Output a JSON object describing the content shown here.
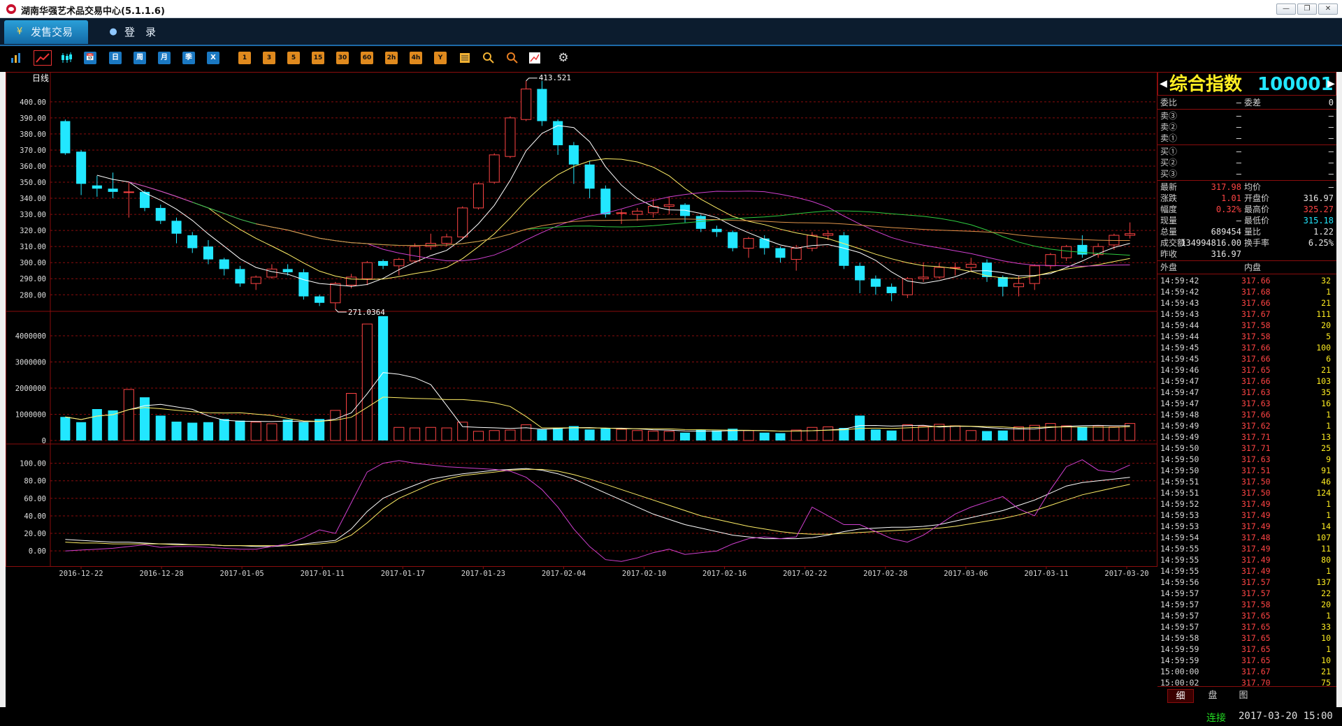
{
  "window": {
    "title": "湖南华强艺术品交易中心(5.1.1.6)",
    "buttons": [
      "—",
      "❐",
      "✕"
    ]
  },
  "nav": {
    "tabs": [
      {
        "label": "发售交易",
        "icon": "yen-icon"
      },
      {
        "label": "登　录",
        "icon": "user-icon"
      }
    ]
  },
  "toolbar": {
    "groups": [
      {
        "kind": "plain",
        "items": [
          "bar-chart-icon",
          "line-chart-icon",
          "candlestick-icon"
        ]
      },
      {
        "kind": "period",
        "items": [
          "📅",
          "日",
          "周",
          "月",
          "季",
          "X"
        ]
      },
      {
        "kind": "minutes",
        "items": [
          "1",
          "3",
          "5",
          "15",
          "30",
          "60",
          "2h",
          "4h",
          "Y"
        ]
      },
      {
        "kind": "tools",
        "items": [
          "list-icon",
          "zoom-in-icon",
          "zoom-out-icon",
          "draw-icon",
          "gear-icon"
        ]
      }
    ]
  },
  "chart_data": {
    "type": "candlestick",
    "period_label": "日线",
    "price_axis": {
      "ticks": [
        "400.00",
        "390.00",
        "380.00",
        "370.00",
        "360.00",
        "350.00",
        "340.00",
        "330.00",
        "320.00",
        "310.00",
        "300.00",
        "290.00",
        "280.00"
      ],
      "ylim": [
        271,
        416
      ]
    },
    "volume_axis": {
      "ticks": [
        "4000000",
        "3000000",
        "2000000",
        "1000000",
        "0"
      ],
      "ylim": [
        0,
        4800000
      ]
    },
    "kdj_axis": {
      "ticks": [
        "100.00",
        "80.00",
        "60.00",
        "40.00",
        "20.00",
        "0.00"
      ],
      "ylim": [
        -15,
        118
      ]
    },
    "date_labels": [
      "2016-12-22",
      "2016-12-28",
      "2017-01-05",
      "2017-01-11",
      "2017-01-17",
      "2017-01-23",
      "2017-02-04",
      "2017-02-10",
      "2017-02-16",
      "2017-02-22",
      "2017-02-28",
      "2017-03-06",
      "2017-03-11",
      "2017-03-20"
    ],
    "annotations": {
      "high": "413.521",
      "low": "271.0364"
    },
    "candles": [
      {
        "o": 388,
        "c": 368,
        "h": 389,
        "l": 367,
        "v": 900000
      },
      {
        "o": 369,
        "c": 349,
        "h": 370,
        "l": 342,
        "v": 700000
      },
      {
        "o": 348,
        "c": 346,
        "h": 354,
        "l": 341,
        "v": 1200000
      },
      {
        "o": 346,
        "c": 344,
        "h": 356,
        "l": 340,
        "v": 1150000
      },
      {
        "o": 344,
        "c": 344,
        "h": 350,
        "l": 328,
        "v": 1950000
      },
      {
        "o": 344,
        "c": 334,
        "h": 345,
        "l": 332,
        "v": 1650000
      },
      {
        "o": 334,
        "c": 326,
        "h": 336,
        "l": 324,
        "v": 950000
      },
      {
        "o": 326,
        "c": 318,
        "h": 328,
        "l": 312,
        "v": 720000
      },
      {
        "o": 317,
        "c": 309,
        "h": 319,
        "l": 306,
        "v": 680000
      },
      {
        "o": 310,
        "c": 302,
        "h": 314,
        "l": 299,
        "v": 700000
      },
      {
        "o": 302,
        "c": 296,
        "h": 303,
        "l": 292,
        "v": 820000
      },
      {
        "o": 296,
        "c": 287,
        "h": 298,
        "l": 285,
        "v": 760000
      },
      {
        "o": 287,
        "c": 291,
        "h": 292,
        "l": 283,
        "v": 700000
      },
      {
        "o": 291,
        "c": 296,
        "h": 299,
        "l": 290,
        "v": 640000
      },
      {
        "o": 296,
        "c": 294,
        "h": 299,
        "l": 292,
        "v": 800000
      },
      {
        "o": 294,
        "c": 279,
        "h": 296,
        "l": 277,
        "v": 700000
      },
      {
        "o": 279,
        "c": 275,
        "h": 280,
        "l": 273,
        "v": 820000
      },
      {
        "o": 275,
        "c": 287,
        "h": 288,
        "l": 271,
        "v": 1150000
      },
      {
        "o": 286,
        "c": 291,
        "h": 293,
        "l": 284,
        "v": 1800000
      },
      {
        "o": 290,
        "c": 300,
        "h": 301,
        "l": 286,
        "v": 4450000
      },
      {
        "o": 301,
        "c": 298,
        "h": 302,
        "l": 296,
        "v": 4750000
      },
      {
        "o": 298,
        "c": 302,
        "h": 303,
        "l": 292,
        "v": 500000
      },
      {
        "o": 301,
        "c": 310,
        "h": 312,
        "l": 300,
        "v": 480000
      },
      {
        "o": 310,
        "c": 312,
        "h": 318,
        "l": 308,
        "v": 500000
      },
      {
        "o": 312,
        "c": 316,
        "h": 318,
        "l": 310,
        "v": 480000
      },
      {
        "o": 316,
        "c": 334,
        "h": 335,
        "l": 315,
        "v": 700000
      },
      {
        "o": 334,
        "c": 349,
        "h": 350,
        "l": 333,
        "v": 350000
      },
      {
        "o": 350,
        "c": 367,
        "h": 368,
        "l": 349,
        "v": 380000
      },
      {
        "o": 366,
        "c": 390,
        "h": 391,
        "l": 365,
        "v": 400000
      },
      {
        "o": 389,
        "c": 408,
        "h": 413,
        "l": 388,
        "v": 600000
      },
      {
        "o": 408,
        "c": 388,
        "h": 413,
        "l": 385,
        "v": 420000
      },
      {
        "o": 388,
        "c": 373,
        "h": 389,
        "l": 367,
        "v": 480000
      },
      {
        "o": 373,
        "c": 361,
        "h": 375,
        "l": 349,
        "v": 550000
      },
      {
        "o": 361,
        "c": 346,
        "h": 363,
        "l": 340,
        "v": 420000
      },
      {
        "o": 346,
        "c": 330,
        "h": 348,
        "l": 328,
        "v": 460000
      },
      {
        "o": 331,
        "c": 331,
        "h": 333,
        "l": 324,
        "v": 430000
      },
      {
        "o": 330,
        "c": 332,
        "h": 334,
        "l": 326,
        "v": 380000
      },
      {
        "o": 331,
        "c": 335,
        "h": 340,
        "l": 328,
        "v": 360000
      },
      {
        "o": 335,
        "c": 336,
        "h": 341,
        "l": 330,
        "v": 350000
      },
      {
        "o": 336,
        "c": 329,
        "h": 337,
        "l": 325,
        "v": 300000
      },
      {
        "o": 329,
        "c": 321,
        "h": 330,
        "l": 319,
        "v": 400000
      },
      {
        "o": 321,
        "c": 319,
        "h": 323,
        "l": 316,
        "v": 380000
      },
      {
        "o": 319,
        "c": 309,
        "h": 320,
        "l": 307,
        "v": 450000
      },
      {
        "o": 309,
        "c": 315,
        "h": 316,
        "l": 303,
        "v": 380000
      },
      {
        "o": 315,
        "c": 309,
        "h": 317,
        "l": 305,
        "v": 300000
      },
      {
        "o": 309,
        "c": 303,
        "h": 310,
        "l": 300,
        "v": 280000
      },
      {
        "o": 302,
        "c": 309,
        "h": 311,
        "l": 295,
        "v": 400000
      },
      {
        "o": 309,
        "c": 317,
        "h": 319,
        "l": 307,
        "v": 500000
      },
      {
        "o": 317,
        "c": 318,
        "h": 320,
        "l": 314,
        "v": 520000
      },
      {
        "o": 317,
        "c": 298,
        "h": 319,
        "l": 296,
        "v": 480000
      },
      {
        "o": 298,
        "c": 289,
        "h": 300,
        "l": 281,
        "v": 950000
      },
      {
        "o": 290,
        "c": 285,
        "h": 292,
        "l": 280,
        "v": 420000
      },
      {
        "o": 285,
        "c": 281,
        "h": 287,
        "l": 276,
        "v": 380000
      },
      {
        "o": 280,
        "c": 290,
        "h": 291,
        "l": 278,
        "v": 600000
      },
      {
        "o": 290,
        "c": 291,
        "h": 300,
        "l": 288,
        "v": 550000
      },
      {
        "o": 291,
        "c": 297,
        "h": 300,
        "l": 290,
        "v": 620000
      },
      {
        "o": 297,
        "c": 297,
        "h": 300,
        "l": 292,
        "v": 560000
      },
      {
        "o": 297,
        "c": 299,
        "h": 303,
        "l": 295,
        "v": 380000
      },
      {
        "o": 300,
        "c": 291,
        "h": 302,
        "l": 288,
        "v": 360000
      },
      {
        "o": 291,
        "c": 285,
        "h": 292,
        "l": 279,
        "v": 380000
      },
      {
        "o": 285,
        "c": 287,
        "h": 292,
        "l": 279,
        "v": 520000
      },
      {
        "o": 287,
        "c": 298,
        "h": 299,
        "l": 283,
        "v": 580000
      },
      {
        "o": 298,
        "c": 305,
        "h": 306,
        "l": 296,
        "v": 650000
      },
      {
        "o": 303,
        "c": 310,
        "h": 311,
        "l": 301,
        "v": 560000
      },
      {
        "o": 311,
        "c": 305,
        "h": 317,
        "l": 303,
        "v": 530000
      },
      {
        "o": 305,
        "c": 310,
        "h": 312,
        "l": 303,
        "v": 560000
      },
      {
        "o": 311,
        "c": 317,
        "h": 318,
        "l": 308,
        "v": 520000
      },
      {
        "o": 317,
        "c": 318,
        "h": 325,
        "l": 315,
        "v": 650000
      }
    ],
    "kdj": {
      "k": [
        13,
        12,
        11,
        10,
        10,
        9,
        8,
        8,
        7,
        7,
        6,
        6,
        5,
        5,
        6,
        8,
        10,
        12,
        25,
        45,
        60,
        68,
        75,
        82,
        85,
        88,
        90,
        92,
        93,
        94,
        92,
        88,
        82,
        74,
        66,
        58,
        50,
        42,
        36,
        30,
        26,
        22,
        18,
        16,
        14,
        14,
        14,
        15,
        18,
        22,
        25,
        26,
        27,
        27,
        28,
        30,
        34,
        38,
        42,
        46,
        52,
        58,
        66,
        74,
        78,
        80,
        82,
        84
      ],
      "d": [
        10,
        9,
        9,
        8,
        8,
        8,
        8,
        7,
        7,
        7,
        6,
        6,
        6,
        6,
        6,
        7,
        8,
        10,
        18,
        32,
        48,
        60,
        68,
        76,
        82,
        86,
        88,
        90,
        92,
        93,
        93,
        91,
        87,
        82,
        76,
        70,
        64,
        58,
        52,
        46,
        40,
        36,
        32,
        28,
        25,
        22,
        20,
        19,
        19,
        20,
        21,
        22,
        23,
        24,
        25,
        26,
        28,
        31,
        34,
        37,
        41,
        46,
        52,
        58,
        64,
        68,
        72,
        76
      ],
      "j": [
        0,
        1,
        2,
        3,
        5,
        7,
        4,
        5,
        5,
        4,
        3,
        2,
        2,
        5,
        8,
        15,
        24,
        20,
        55,
        90,
        100,
        103,
        100,
        98,
        96,
        95,
        94,
        93,
        91,
        84,
        70,
        50,
        25,
        5,
        -10,
        -12,
        -8,
        -2,
        2,
        -4,
        -2,
        0,
        8,
        14,
        16,
        14,
        16,
        50,
        40,
        30,
        30,
        22,
        14,
        10,
        18,
        30,
        42,
        50,
        56,
        62,
        48,
        40,
        70,
        96,
        104,
        92,
        90,
        98
      ]
    }
  },
  "quote": {
    "name": "综合指数",
    "code": "100001",
    "weibi": {
      "label": "委比",
      "value": "—",
      "label2": "委差",
      "value2": "0"
    },
    "sells": [
      {
        "label": "卖③",
        "price": "—",
        "vol": "—"
      },
      {
        "label": "卖②",
        "price": "—",
        "vol": "—"
      },
      {
        "label": "卖①",
        "price": "—",
        "vol": "—"
      }
    ],
    "buys": [
      {
        "label": "买①",
        "price": "—",
        "vol": "—"
      },
      {
        "label": "买②",
        "price": "—",
        "vol": "—"
      },
      {
        "label": "买③",
        "price": "—",
        "vol": "—"
      }
    ],
    "stats": [
      {
        "l1": "最新",
        "v1": "317.98",
        "c1": "red",
        "l2": "均价",
        "v2": "—",
        "c2": "white"
      },
      {
        "l1": "涨跌",
        "v1": "1.01",
        "c1": "red",
        "l2": "开盘价",
        "v2": "316.97",
        "c2": "white"
      },
      {
        "l1": "幅度",
        "v1": "0.32%",
        "c1": "red",
        "l2": "最高价",
        "v2": "325.27",
        "c2": "red"
      },
      {
        "l1": "现量",
        "v1": "—",
        "c1": "white",
        "l2": "最低价",
        "v2": "315.18",
        "c2": "cyan"
      },
      {
        "l1": "总量",
        "v1": "689454",
        "c1": "white",
        "l2": "量比",
        "v2": "1.22",
        "c2": "white"
      },
      {
        "l1": "成交额",
        "v1": "134994816.00",
        "c1": "white",
        "l2": "换手率",
        "v2": "6.25%",
        "c2": "white"
      },
      {
        "l1": "昨收",
        "v1": "316.97",
        "c1": "white",
        "l2": "",
        "v2": "",
        "c2": "white"
      }
    ],
    "outer_label": "外盘",
    "inner_label": "内盘",
    "ticks": [
      [
        "14:59:42",
        "317.66",
        "32"
      ],
      [
        "14:59:42",
        "317.68",
        "1"
      ],
      [
        "14:59:43",
        "317.66",
        "21"
      ],
      [
        "14:59:43",
        "317.67",
        "111"
      ],
      [
        "14:59:44",
        "317.58",
        "20"
      ],
      [
        "14:59:44",
        "317.58",
        "5"
      ],
      [
        "14:59:45",
        "317.66",
        "100"
      ],
      [
        "14:59:45",
        "317.66",
        "6"
      ],
      [
        "14:59:46",
        "317.65",
        "21"
      ],
      [
        "14:59:47",
        "317.66",
        "103"
      ],
      [
        "14:59:47",
        "317.63",
        "35"
      ],
      [
        "14:59:47",
        "317.63",
        "16"
      ],
      [
        "14:59:48",
        "317.66",
        "1"
      ],
      [
        "14:59:49",
        "317.62",
        "1"
      ],
      [
        "14:59:49",
        "317.71",
        "13"
      ],
      [
        "14:59:50",
        "317.71",
        "25"
      ],
      [
        "14:59:50",
        "317.63",
        "9"
      ],
      [
        "14:59:50",
        "317.51",
        "91"
      ],
      [
        "14:59:51",
        "317.50",
        "46"
      ],
      [
        "14:59:51",
        "317.50",
        "124"
      ],
      [
        "14:59:52",
        "317.49",
        "1"
      ],
      [
        "14:59:53",
        "317.49",
        "1"
      ],
      [
        "14:59:53",
        "317.49",
        "14"
      ],
      [
        "14:59:54",
        "317.48",
        "107"
      ],
      [
        "14:59:55",
        "317.49",
        "11"
      ],
      [
        "14:59:55",
        "317.49",
        "80"
      ],
      [
        "14:59:55",
        "317.49",
        "1"
      ],
      [
        "14:59:56",
        "317.57",
        "137"
      ],
      [
        "14:59:57",
        "317.57",
        "22"
      ],
      [
        "14:59:57",
        "317.58",
        "20"
      ],
      [
        "14:59:57",
        "317.65",
        "1"
      ],
      [
        "14:59:57",
        "317.65",
        "33"
      ],
      [
        "14:59:58",
        "317.65",
        "10"
      ],
      [
        "14:59:59",
        "317.65",
        "1"
      ],
      [
        "14:59:59",
        "317.65",
        "10"
      ],
      [
        "15:00:00",
        "317.67",
        "21"
      ],
      [
        "15:00:02",
        "317.70",
        "75"
      ]
    ],
    "tabs": [
      "细",
      "盘",
      "图"
    ]
  },
  "status": {
    "connection": "连接",
    "datetime": "2017-03-20 15:00"
  },
  "colors": {
    "up": "#ff4444",
    "down": "#22e7ff",
    "grid": "#8a0d0d",
    "ma5": "#ffffff",
    "ma10": "#ffee66",
    "ma20": "#d040d0",
    "ma30": "#2ecc40",
    "ma60": "#e0944a"
  }
}
